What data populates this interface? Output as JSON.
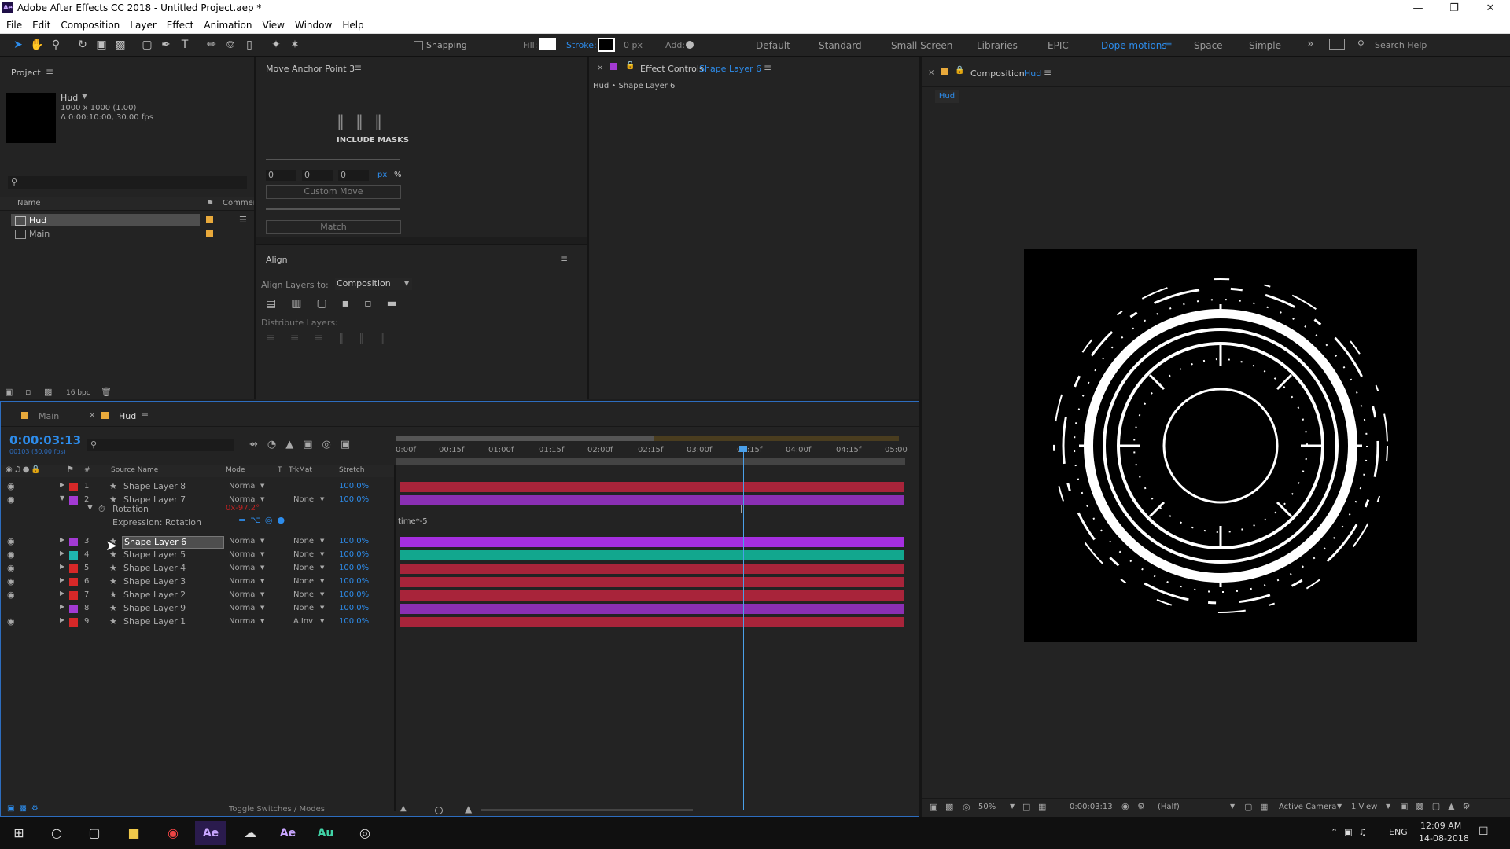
{
  "app": {
    "title": "Adobe After Effects CC 2018 - Untitled Project.aep *",
    "icon": "Ae"
  },
  "menu": [
    "File",
    "Edit",
    "Composition",
    "Layer",
    "Effect",
    "Animation",
    "View",
    "Window",
    "Help"
  ],
  "toolbar": {
    "snapping": "Snapping",
    "fill": "Fill:",
    "stroke": "Stroke:",
    "stroke_px": "0 px",
    "add": "Add:",
    "workspaces": [
      "Default",
      "Standard",
      "Small Screen",
      "Libraries",
      "EPIC",
      "Dope motions",
      "Space",
      "Simple"
    ],
    "active_workspace": "Dope motions",
    "search": "Search Help"
  },
  "project": {
    "title": "Project",
    "comp_name": "Hud",
    "comp_info1": "1000 x 1000 (1.00)",
    "comp_info2": "Δ 0:00:10:00, 30.00 fps",
    "col_name": "Name",
    "col_comment": "Commen",
    "items": [
      "Hud",
      "Main"
    ],
    "bpc": "16 bpc"
  },
  "move_anchor": {
    "title": "Move Anchor Point 3",
    "include_masks": "INCLUDE MASKS",
    "v1": "0",
    "v2": "0",
    "v3": "0",
    "unit_px": "px",
    "unit_pct": "%",
    "custom_move": "Custom Move",
    "match": "Match"
  },
  "align": {
    "title": "Align",
    "align_to_label": "Align Layers to:",
    "align_to_value": "Composition",
    "distribute": "Distribute Layers:"
  },
  "effect_controls": {
    "title_prefix": "Effect Controls",
    "layer": "Shape Layer 6",
    "path": "Hud • Shape Layer 6"
  },
  "composition": {
    "title_prefix": "Composition",
    "name": "Hud",
    "tab": "Hud",
    "zoom": "50%",
    "timecode": "0:00:03:13",
    "resolution": "(Half)",
    "camera": "Active Camera",
    "view": "1 View"
  },
  "timeline": {
    "tabs": [
      "Main",
      "Hud"
    ],
    "timecode": "0:00:03:13",
    "frame_info": "00103 (30.00 fps)",
    "ruler": [
      "0:00f",
      "00:15f",
      "01:00f",
      "01:15f",
      "02:00f",
      "02:15f",
      "03:00f",
      "03:15f",
      "04:00f",
      "04:15f",
      "05:00"
    ],
    "col_num": "#",
    "col_source": "Source Name",
    "col_mode": "Mode",
    "col_t": "T",
    "col_trkmat": "TrkMat",
    "col_stretch": "Stretch",
    "rotation_label": "Rotation",
    "rotation_value": "0x-97.2°",
    "expression_label": "Expression: Rotation",
    "expression_text": "time*-5",
    "toggle": "Toggle Switches / Modes",
    "layers": [
      {
        "num": "1",
        "name": "Shape Layer 8",
        "mode": "Norma",
        "trkmat": "",
        "stretch": "100.0%",
        "label": "#d62828",
        "bar": "#a8243a",
        "eye": true
      },
      {
        "num": "2",
        "name": "Shape Layer 7",
        "mode": "Norma",
        "trkmat": "None",
        "stretch": "100.0%",
        "label": "#a33ad3",
        "bar": "#8a2fb3",
        "eye": true
      },
      {
        "num": "3",
        "name": "Shape Layer 6",
        "mode": "Norma",
        "trkmat": "None",
        "stretch": "100.0%",
        "label": "#a33ad3",
        "bar": "#a52ee0",
        "eye": true
      },
      {
        "num": "4",
        "name": "Shape Layer 5",
        "mode": "Norma",
        "trkmat": "None",
        "stretch": "100.0%",
        "label": "#1fb6b0",
        "bar": "#12a78e",
        "eye": true
      },
      {
        "num": "5",
        "name": "Shape Layer 4",
        "mode": "Norma",
        "trkmat": "None",
        "stretch": "100.0%",
        "label": "#d62828",
        "bar": "#a8243a",
        "eye": true
      },
      {
        "num": "6",
        "name": "Shape Layer 3",
        "mode": "Norma",
        "trkmat": "None",
        "stretch": "100.0%",
        "label": "#d62828",
        "bar": "#a8243a",
        "eye": true
      },
      {
        "num": "7",
        "name": "Shape Layer 2",
        "mode": "Norma",
        "trkmat": "None",
        "stretch": "100.0%",
        "label": "#d62828",
        "bar": "#a8243a",
        "eye": true
      },
      {
        "num": "8",
        "name": "Shape Layer 9",
        "mode": "Norma",
        "trkmat": "None",
        "stretch": "100.0%",
        "label": "#a33ad3",
        "bar": "#8a2fb3",
        "eye": false
      },
      {
        "num": "9",
        "name": "Shape Layer 1",
        "mode": "Norma",
        "trkmat": "A.Inv",
        "stretch": "100.0%",
        "label": "#d62828",
        "bar": "#a8243a",
        "eye": true
      }
    ]
  },
  "taskbar": {
    "lang": "ENG",
    "time": "12:09 AM",
    "date": "14-08-2018"
  },
  "colors": {
    "accent": "#2d8ceb",
    "panel": "#232323",
    "playhead": "#4a9fe8"
  }
}
